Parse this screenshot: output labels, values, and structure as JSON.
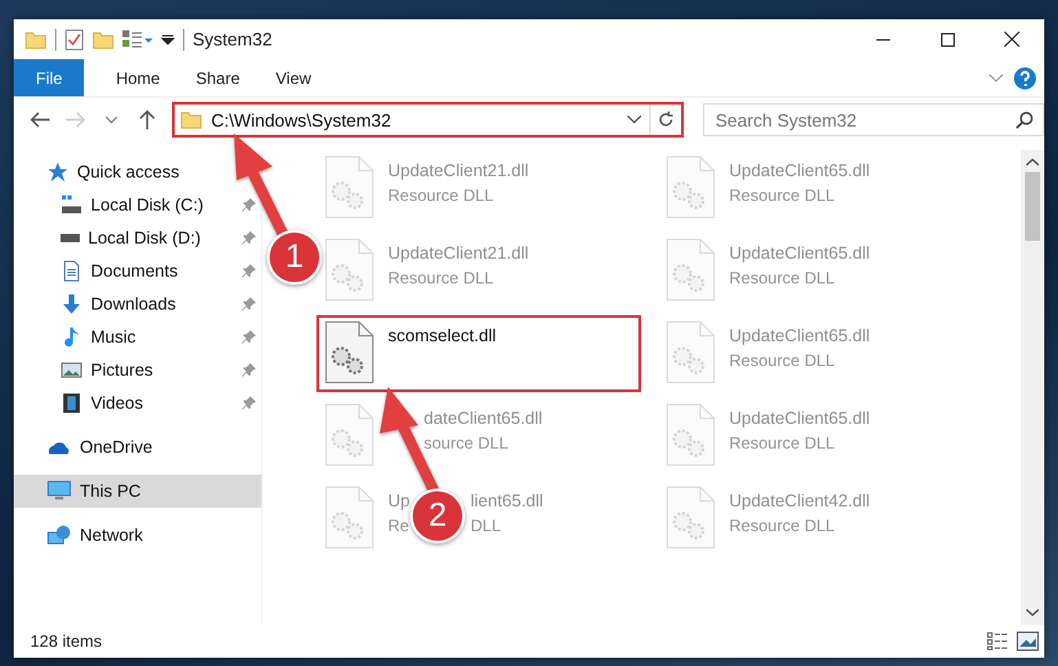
{
  "window": {
    "title": "System32"
  },
  "ribbon_tabs": [
    {
      "label": "File",
      "kind": "file"
    },
    {
      "label": "Home",
      "kind": "tab"
    },
    {
      "label": "Share",
      "kind": "tab"
    },
    {
      "label": "View",
      "kind": "tab"
    }
  ],
  "nav": {
    "forward_disabled": true
  },
  "address_bar": {
    "value": "C:\\Windows\\System32",
    "highlighted": true
  },
  "search": {
    "placeholder": "Search System32"
  },
  "sidebar": {
    "items": [
      {
        "label": "Quick access",
        "kind": "section",
        "selected": false,
        "children": [
          {
            "label": "Local Disk (C:)",
            "pinned": true
          },
          {
            "label": "Local Disk (D:)",
            "pinned": true
          },
          {
            "label": "Documents",
            "pinned": true
          },
          {
            "label": "Downloads",
            "pinned": true
          },
          {
            "label": "Music",
            "pinned": true
          },
          {
            "label": "Pictures",
            "pinned": true
          },
          {
            "label": "Videos",
            "pinned": true
          }
        ]
      },
      {
        "label": "OneDrive",
        "kind": "section",
        "selected": false
      },
      {
        "label": "This PC",
        "kind": "section",
        "selected": true
      },
      {
        "label": "Network",
        "kind": "section",
        "selected": false
      }
    ]
  },
  "files": [
    {
      "name": "UpdateClient21.dll",
      "type": "Resource DLL",
      "faded": true,
      "highlighted": false
    },
    {
      "name": "UpdateClient65.dll",
      "type": "Resource DLL",
      "faded": true,
      "highlighted": false
    },
    {
      "name": "UpdateClient21.dll",
      "type": "Resource DLL",
      "faded": true,
      "highlighted": false
    },
    {
      "name": "UpdateClient65.dll",
      "type": "Resource DLL",
      "faded": true,
      "highlighted": false
    },
    {
      "name": "scomselect.dll",
      "faded": false,
      "highlighted": true
    },
    {
      "name": "UpdateClient65.dll",
      "type": "Resource DLL",
      "faded": true,
      "highlighted": false
    },
    {
      "name": [
        "dateClient65.dll"
      ],
      "type": [
        "source DLL"
      ],
      "covered_start": true,
      "faded": true,
      "highlighted": false
    },
    {
      "name": "UpdateClient65.dll",
      "type": "Resource DLL",
      "faded": true,
      "highlighted": false
    },
    {
      "name": [
        "Up",
        "lient65.dll"
      ],
      "type": [
        "Re",
        "DLL"
      ],
      "covered_start": false,
      "faded": true,
      "highlighted": false
    },
    {
      "name": "UpdateClient42.dll",
      "type": "Resource DLL",
      "faded": true,
      "highlighted": false
    }
  ],
  "status_bar": {
    "count": "128 items"
  },
  "annotations": [
    {
      "label": "1"
    },
    {
      "label": "2"
    }
  ]
}
